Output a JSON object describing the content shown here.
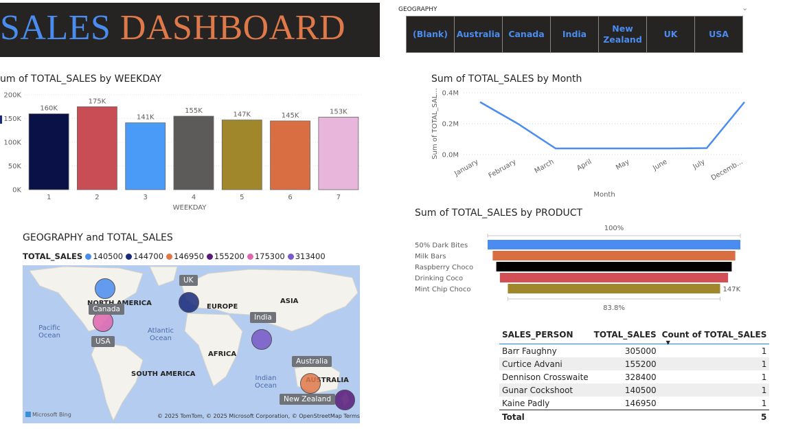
{
  "title": {
    "part1": "SALES",
    "part2": "DASHBOARD"
  },
  "slicer": {
    "label": "GEOGRAPHY",
    "options": [
      "(Blank)",
      "Australia",
      "Canada",
      "India",
      "New Zealand",
      "UK",
      "USA"
    ]
  },
  "weekday_chart": {
    "title": "um of TOTAL_SALES by WEEKDAY",
    "xlabel": "WEEKDAY",
    "yticks": [
      "0K",
      "50K",
      "100K",
      "150K",
      "200K"
    ]
  },
  "month_chart": {
    "title": "Sum of TOTAL_SALES by Month",
    "xlabel": "Month",
    "ylabel": "Sum of TOTAL_SAL...",
    "yticks": [
      "0.0M",
      "0.2M",
      "0.4M"
    ]
  },
  "product_chart": {
    "title": "Sum of TOTAL_SALES by PRODUCT",
    "top_label": "100%",
    "bottom_label": "83.8%",
    "end_label": "147K"
  },
  "map": {
    "title": "GEOGRAPHY and TOTAL_SALES",
    "legend_title": "TOTAL_SALES",
    "legend": [
      {
        "label": "140500",
        "color": "#4a8cf0"
      },
      {
        "label": "144700",
        "color": "#1a2a7a"
      },
      {
        "label": "146950",
        "color": "#e0794a"
      },
      {
        "label": "155200",
        "color": "#5a1a7a"
      },
      {
        "label": "175300",
        "color": "#e066b0"
      },
      {
        "label": "313400",
        "color": "#7a5ac8"
      }
    ],
    "continents": {
      "north_america": "NORTH AMERICA",
      "europe": "EUROPE",
      "asia": "ASIA",
      "africa": "AFRICA",
      "south_america": "SOUTH AMERICA",
      "australia": "AUSTRALIA"
    },
    "oceans": {
      "pacific": "Pacific Ocean",
      "atlantic": "Atlantic Ocean",
      "indian": "Indian Ocean"
    },
    "tooltips": {
      "uk": "UK",
      "canada": "Canada",
      "usa": "USA",
      "india": "India",
      "australia": "Australia",
      "new_zealand": "New Zealand"
    },
    "bing": "Microsoft Bing",
    "attribution": "© 2025 TomTom, © 2025 Microsoft Corporation, © OpenStreetMap  Terms"
  },
  "table": {
    "headers": [
      "SALES_PERSON",
      "TOTAL_SALES",
      "Count of TOTAL_SALES"
    ],
    "rows": [
      {
        "name": "Barr Faughny",
        "sales": "305000",
        "count": "1"
      },
      {
        "name": "Curtice Advani",
        "sales": "155200",
        "count": "1"
      },
      {
        "name": "Dennison Crosswaite",
        "sales": "328400",
        "count": "1"
      },
      {
        "name": "Gunar Cockshoot",
        "sales": "140500",
        "count": "1"
      },
      {
        "name": "Kaine Padly",
        "sales": "146950",
        "count": "1"
      }
    ],
    "total": {
      "label": "Total",
      "count": "5"
    }
  },
  "chart_data": [
    {
      "type": "bar",
      "title": "um of TOTAL_SALES by WEEKDAY",
      "xlabel": "WEEKDAY",
      "categories": [
        "1",
        "2",
        "3",
        "4",
        "5",
        "6",
        "7"
      ],
      "values": [
        160000,
        175000,
        141000,
        155000,
        147000,
        145000,
        153000
      ],
      "data_labels": [
        "160K",
        "175K",
        "141K",
        "155K",
        "147K",
        "145K",
        "153K"
      ],
      "colors": [
        "#0a1147",
        "#c94d55",
        "#4a9bf7",
        "#5c5b5a",
        "#a1872b",
        "#da6e43",
        "#e8b6da"
      ],
      "ylim": [
        0,
        200000
      ],
      "grid": true
    },
    {
      "type": "line",
      "title": "Sum of TOTAL_SALES by Month",
      "xlabel": "Month",
      "ylabel": "Sum of TOTAL_SAL...",
      "categories": [
        "January",
        "February",
        "March",
        "April",
        "May",
        "June",
        "July",
        "Decemb..."
      ],
      "values": [
        340000,
        200000,
        40000,
        40000,
        40000,
        40000,
        42000,
        340000
      ],
      "color": "#4a8cf0",
      "ylim": [
        0,
        400000
      ],
      "grid": true
    },
    {
      "type": "bar",
      "title": "Sum of TOTAL_SALES by PRODUCT",
      "orientation": "horizontal-funnel",
      "categories": [
        "50% Dark Bites",
        "Milk Bars",
        "Raspberry Choco",
        "Drinking Coco",
        "Mint Chip Choco"
      ],
      "values": [
        175000,
        168000,
        163000,
        158000,
        147000
      ],
      "colors": [
        "#4a8cf0",
        "#da6e43",
        "#000000",
        "#d14f55",
        "#a1872b"
      ]
    }
  ]
}
